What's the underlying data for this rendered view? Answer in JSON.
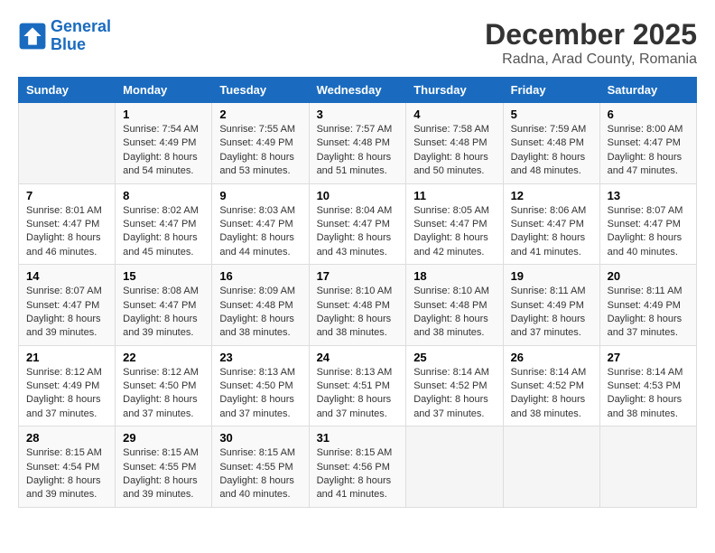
{
  "logo": {
    "line1": "General",
    "line2": "Blue"
  },
  "title": "December 2025",
  "subtitle": "Radna, Arad County, Romania",
  "days_of_week": [
    "Sunday",
    "Monday",
    "Tuesday",
    "Wednesday",
    "Thursday",
    "Friday",
    "Saturday"
  ],
  "weeks": [
    [
      {
        "day": "",
        "info": ""
      },
      {
        "day": "1",
        "info": "Sunrise: 7:54 AM\nSunset: 4:49 PM\nDaylight: 8 hours\nand 54 minutes."
      },
      {
        "day": "2",
        "info": "Sunrise: 7:55 AM\nSunset: 4:49 PM\nDaylight: 8 hours\nand 53 minutes."
      },
      {
        "day": "3",
        "info": "Sunrise: 7:57 AM\nSunset: 4:48 PM\nDaylight: 8 hours\nand 51 minutes."
      },
      {
        "day": "4",
        "info": "Sunrise: 7:58 AM\nSunset: 4:48 PM\nDaylight: 8 hours\nand 50 minutes."
      },
      {
        "day": "5",
        "info": "Sunrise: 7:59 AM\nSunset: 4:48 PM\nDaylight: 8 hours\nand 48 minutes."
      },
      {
        "day": "6",
        "info": "Sunrise: 8:00 AM\nSunset: 4:47 PM\nDaylight: 8 hours\nand 47 minutes."
      }
    ],
    [
      {
        "day": "7",
        "info": "Sunrise: 8:01 AM\nSunset: 4:47 PM\nDaylight: 8 hours\nand 46 minutes."
      },
      {
        "day": "8",
        "info": "Sunrise: 8:02 AM\nSunset: 4:47 PM\nDaylight: 8 hours\nand 45 minutes."
      },
      {
        "day": "9",
        "info": "Sunrise: 8:03 AM\nSunset: 4:47 PM\nDaylight: 8 hours\nand 44 minutes."
      },
      {
        "day": "10",
        "info": "Sunrise: 8:04 AM\nSunset: 4:47 PM\nDaylight: 8 hours\nand 43 minutes."
      },
      {
        "day": "11",
        "info": "Sunrise: 8:05 AM\nSunset: 4:47 PM\nDaylight: 8 hours\nand 42 minutes."
      },
      {
        "day": "12",
        "info": "Sunrise: 8:06 AM\nSunset: 4:47 PM\nDaylight: 8 hours\nand 41 minutes."
      },
      {
        "day": "13",
        "info": "Sunrise: 8:07 AM\nSunset: 4:47 PM\nDaylight: 8 hours\nand 40 minutes."
      }
    ],
    [
      {
        "day": "14",
        "info": "Sunrise: 8:07 AM\nSunset: 4:47 PM\nDaylight: 8 hours\nand 39 minutes."
      },
      {
        "day": "15",
        "info": "Sunrise: 8:08 AM\nSunset: 4:47 PM\nDaylight: 8 hours\nand 39 minutes."
      },
      {
        "day": "16",
        "info": "Sunrise: 8:09 AM\nSunset: 4:48 PM\nDaylight: 8 hours\nand 38 minutes."
      },
      {
        "day": "17",
        "info": "Sunrise: 8:10 AM\nSunset: 4:48 PM\nDaylight: 8 hours\nand 38 minutes."
      },
      {
        "day": "18",
        "info": "Sunrise: 8:10 AM\nSunset: 4:48 PM\nDaylight: 8 hours\nand 38 minutes."
      },
      {
        "day": "19",
        "info": "Sunrise: 8:11 AM\nSunset: 4:49 PM\nDaylight: 8 hours\nand 37 minutes."
      },
      {
        "day": "20",
        "info": "Sunrise: 8:11 AM\nSunset: 4:49 PM\nDaylight: 8 hours\nand 37 minutes."
      }
    ],
    [
      {
        "day": "21",
        "info": "Sunrise: 8:12 AM\nSunset: 4:49 PM\nDaylight: 8 hours\nand 37 minutes."
      },
      {
        "day": "22",
        "info": "Sunrise: 8:12 AM\nSunset: 4:50 PM\nDaylight: 8 hours\nand 37 minutes."
      },
      {
        "day": "23",
        "info": "Sunrise: 8:13 AM\nSunset: 4:50 PM\nDaylight: 8 hours\nand 37 minutes."
      },
      {
        "day": "24",
        "info": "Sunrise: 8:13 AM\nSunset: 4:51 PM\nDaylight: 8 hours\nand 37 minutes."
      },
      {
        "day": "25",
        "info": "Sunrise: 8:14 AM\nSunset: 4:52 PM\nDaylight: 8 hours\nand 37 minutes."
      },
      {
        "day": "26",
        "info": "Sunrise: 8:14 AM\nSunset: 4:52 PM\nDaylight: 8 hours\nand 38 minutes."
      },
      {
        "day": "27",
        "info": "Sunrise: 8:14 AM\nSunset: 4:53 PM\nDaylight: 8 hours\nand 38 minutes."
      }
    ],
    [
      {
        "day": "28",
        "info": "Sunrise: 8:15 AM\nSunset: 4:54 PM\nDaylight: 8 hours\nand 39 minutes."
      },
      {
        "day": "29",
        "info": "Sunrise: 8:15 AM\nSunset: 4:55 PM\nDaylight: 8 hours\nand 39 minutes."
      },
      {
        "day": "30",
        "info": "Sunrise: 8:15 AM\nSunset: 4:55 PM\nDaylight: 8 hours\nand 40 minutes."
      },
      {
        "day": "31",
        "info": "Sunrise: 8:15 AM\nSunset: 4:56 PM\nDaylight: 8 hours\nand 41 minutes."
      },
      {
        "day": "",
        "info": ""
      },
      {
        "day": "",
        "info": ""
      },
      {
        "day": "",
        "info": ""
      }
    ]
  ]
}
